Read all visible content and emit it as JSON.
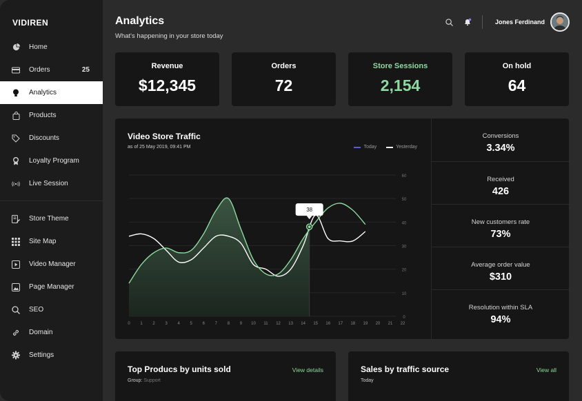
{
  "brand": "VIDIREN",
  "nav": [
    {
      "label": "Home",
      "icon": "pie-chart-icon"
    },
    {
      "label": "Orders",
      "icon": "card-icon",
      "count": "25"
    },
    {
      "label": "Analytics",
      "icon": "bulb-icon",
      "active": true
    },
    {
      "label": "Products",
      "icon": "bag-icon"
    },
    {
      "label": "Discounts",
      "icon": "tag-icon"
    },
    {
      "label": "Loyalty Program",
      "icon": "badge-icon"
    },
    {
      "label": "Live Session",
      "icon": "broadcast-icon"
    },
    {
      "label": "Store Theme",
      "icon": "edit-doc-icon"
    },
    {
      "label": "Site Map",
      "icon": "grid-icon"
    },
    {
      "label": "Video Manager",
      "icon": "play-icon"
    },
    {
      "label": "Page Manager",
      "icon": "image-icon"
    },
    {
      "label": "SEO",
      "icon": "search-icon"
    },
    {
      "label": "Domain",
      "icon": "link-icon"
    },
    {
      "label": "Settings",
      "icon": "gear-icon"
    }
  ],
  "header": {
    "title": "Analytics",
    "subtitle": "What's happening in your store today",
    "user_name": "Jones Ferdinand"
  },
  "stats": [
    {
      "label": "Revenue",
      "value": "$12,345"
    },
    {
      "label": "Orders",
      "value": "72"
    },
    {
      "label": "Store Sessions",
      "value": "2,154",
      "accent": true
    },
    {
      "label": "On hold",
      "value": "64"
    }
  ],
  "traffic": {
    "title": "Video Store Traffic",
    "subtitle": "as of 25 May 2019, 09:41 PM",
    "legend_today": "Today",
    "legend_yesterday": "Yesterday",
    "tooltip_value": "38"
  },
  "chart_data": {
    "type": "line",
    "x": [
      0,
      1,
      2,
      3,
      4,
      5,
      6,
      7,
      8,
      9,
      10,
      11,
      12,
      13,
      14,
      15,
      16,
      17,
      18,
      19,
      20,
      21,
      22
    ],
    "ylim": [
      0,
      60
    ],
    "yticks": [
      0,
      10,
      20,
      30,
      40,
      50,
      60
    ],
    "series": [
      {
        "name": "Today",
        "x": [
          0,
          1,
          2,
          3,
          4,
          5,
          6,
          7,
          8,
          9,
          10,
          11,
          12,
          13,
          14,
          15,
          16,
          17,
          18,
          19
        ],
        "values": [
          14,
          22,
          27,
          29,
          27,
          28,
          35,
          45,
          50,
          37,
          24,
          18,
          18,
          24,
          33,
          40,
          46,
          48,
          45,
          39
        ]
      },
      {
        "name": "Yesterday",
        "x": [
          0,
          1,
          2,
          3,
          4,
          5,
          6,
          7,
          8,
          9,
          10,
          11,
          12,
          13,
          14,
          15,
          16,
          17,
          18,
          19
        ],
        "values": [
          34,
          35,
          33,
          28,
          23,
          24,
          29,
          34,
          34,
          31,
          22,
          20,
          17,
          20,
          30,
          43,
          33,
          32,
          32,
          36
        ]
      }
    ],
    "highlight": {
      "x": 14.5,
      "value": 38
    },
    "colors": {
      "today": "#8ed9a0",
      "yesterday": "#ffffff",
      "legend_today": "#5b5bd6",
      "legend_yesterday": "#ffffff"
    }
  },
  "kpis": [
    {
      "label": "Conversions",
      "value": "3.34%"
    },
    {
      "label": "Received",
      "value": "426"
    },
    {
      "label": "New customers rate",
      "value": "73%"
    },
    {
      "label": "Average order value",
      "value": "$310"
    },
    {
      "label": "Resolution within SLA",
      "value": "94%"
    }
  ],
  "bottom": {
    "left_title": "Top Producs by units sold",
    "left_sub_label": "Group:",
    "left_sub_value": "Support",
    "left_link": "View details",
    "right_title": "Sales by traffic source",
    "right_sub": "Today",
    "right_link": "View all"
  }
}
